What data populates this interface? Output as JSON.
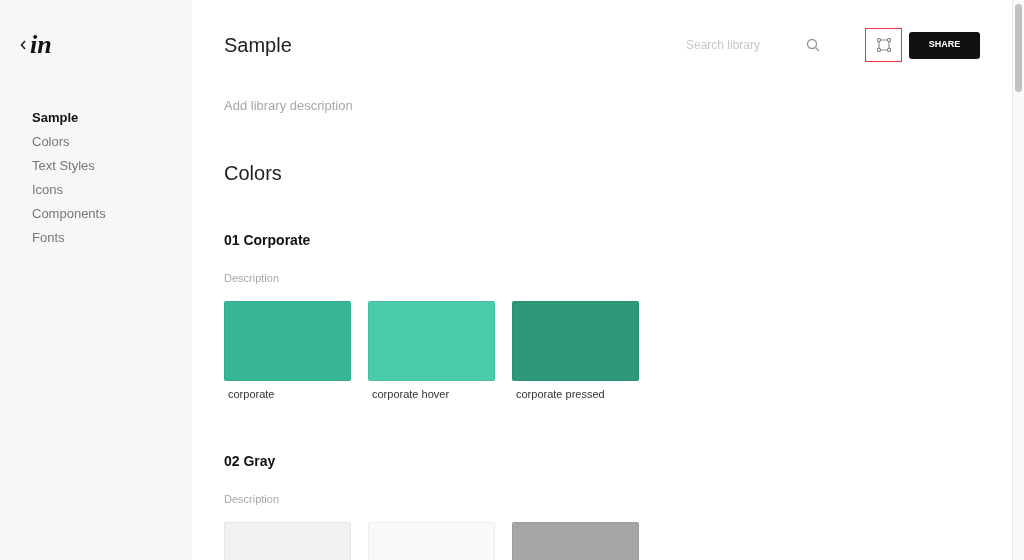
{
  "sidebar": {
    "logo": "in",
    "items": [
      {
        "label": "Sample",
        "selected": true
      },
      {
        "label": "Colors",
        "selected": false
      },
      {
        "label": "Text Styles",
        "selected": false
      },
      {
        "label": "Icons",
        "selected": false
      },
      {
        "label": "Components",
        "selected": false
      },
      {
        "label": "Fonts",
        "selected": false
      }
    ]
  },
  "header": {
    "title": "Sample",
    "search": {
      "placeholder": "Search library"
    },
    "inspect_button": {
      "highlighted": true
    },
    "share_button": "SHARE"
  },
  "description_placeholder": "Add library description",
  "section_title": "Colors",
  "groups": [
    {
      "title": "01 Corporate",
      "description": "Description",
      "swatches": [
        {
          "label": "corporate",
          "color": "#36b693"
        },
        {
          "label": "corporate hover",
          "color": "#4acca8"
        },
        {
          "label": "corporate pressed",
          "color": "#2d997a"
        }
      ]
    },
    {
      "title": "02 Gray",
      "description": "Description",
      "swatches": [
        {
          "color": "#f2f2f2"
        },
        {
          "color": "#f9f9f9"
        },
        {
          "color": "#a6a6a6"
        }
      ]
    }
  ]
}
